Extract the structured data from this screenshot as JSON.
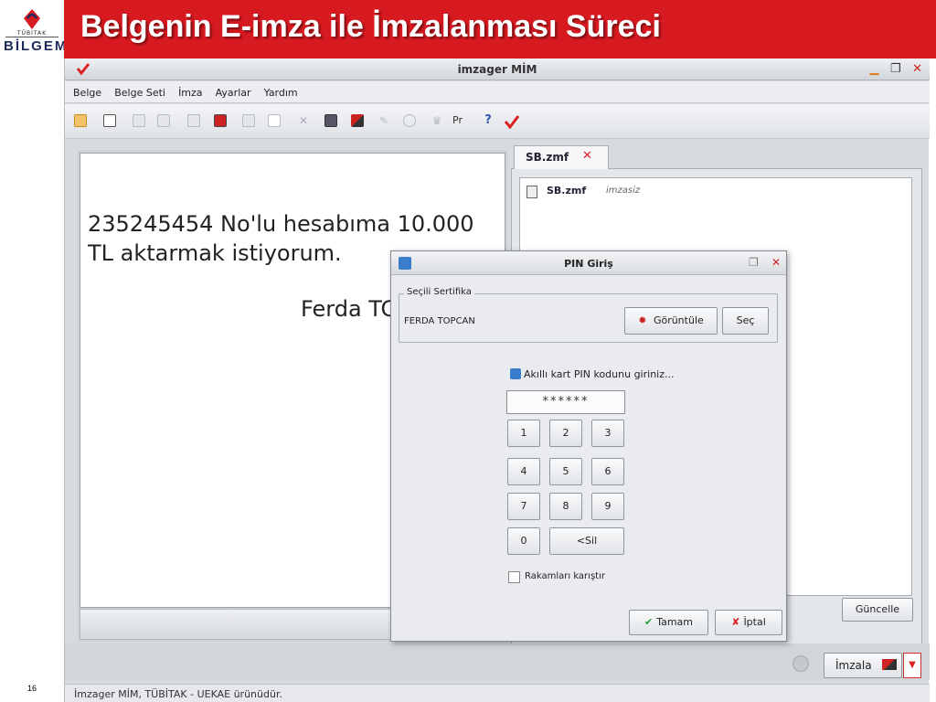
{
  "slide": {
    "title": "Belgenin E-imza ile İmzalanması Süreci",
    "page_number": "16",
    "logo_subtitle": "TÜBİTAK",
    "logo_text": "BİLGEM"
  },
  "app": {
    "title": "imzager MİM",
    "menu": [
      "Belge",
      "Belge Seti",
      "İmza",
      "Ayarlar",
      "Yardım"
    ],
    "toolbar_text_item": "Pr",
    "help_glyph": "?"
  },
  "document": {
    "text": "235245454 No'lu hesabıma 10.000 TL aktarmak istiyorum.",
    "signature_visible": "Ferda TC"
  },
  "right_pane": {
    "tab_label": "SB.zmf",
    "tree_item_name": "SB.zmf",
    "tree_item_status": "imzasiz",
    "update_button": "Güncelle"
  },
  "bottom": {
    "sign_button": "İmzala",
    "status_text": "İmzager MİM, TÜBİTAK - UEKAE ürünüdür."
  },
  "pin_dialog": {
    "title": "PIN Giriş",
    "cert_group_label": "Seçili Sertifika",
    "cert_name": "FERDA TOPCAN",
    "view_button": "Görüntüle",
    "select_button": "Seç",
    "prompt": "Akıllı kart PIN kodunu giriniz...",
    "pin_value": "******",
    "keys": {
      "k1": "1",
      "k2": "2",
      "k3": "3",
      "k4": "4",
      "k5": "5",
      "k6": "6",
      "k7": "7",
      "k8": "8",
      "k9": "9",
      "k0": "0",
      "del": "<Sil"
    },
    "shuffle_label": "Rakamları karıştır",
    "shuffle_checked": false,
    "ok_button": "Tamam",
    "cancel_button": "İptal"
  },
  "colors": {
    "title_bar": "#d71920",
    "window_bg": "#d7dbe0",
    "accent_blue": "#3c7ccd",
    "accent_red": "#d22222",
    "ok_green": "#2a9a3a"
  }
}
